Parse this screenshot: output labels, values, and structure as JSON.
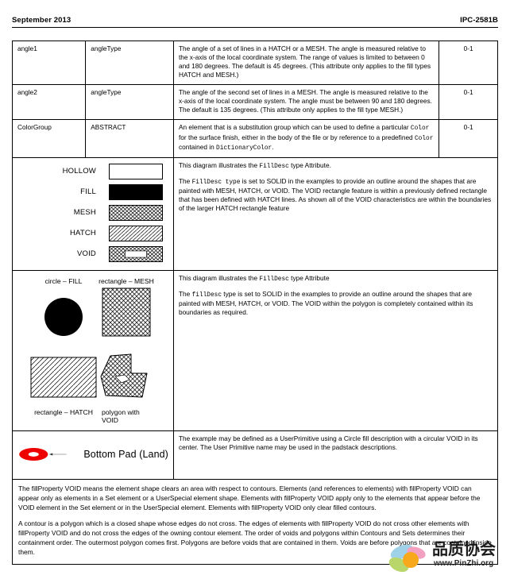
{
  "header": {
    "date": "September 2013",
    "standard": "IPC-2581B"
  },
  "attribute_table": {
    "rows": [
      {
        "name": "angle1",
        "type": "angleType",
        "description": "The angle of a set of lines in a HATCH or a MESH. The angle is measured relative to the x-axis of the local coordinate system. The range of values is limited to between 0 and  180 degrees. The default is 45 degrees. (This attribute only applies to the fill types HATCH and MESH.)",
        "cardinality": "0-1"
      },
      {
        "name": "angle2",
        "type": "angleType",
        "description": "The angle of the second set of lines in a MESH. The angle is measured relative to the x-axis of the local coordinate system. The angle must be between 90 and 180 degrees. The default is 135 degrees. (This attribute only applies to the  fill  type MESH.)",
        "cardinality": "0-1"
      },
      {
        "name": "ColorGroup",
        "type": "ABSTRACT",
        "description_parts": [
          {
            "text": "An element that is a substitution group which can be used to define a particular ",
            "mono": false
          },
          {
            "text": "Color",
            "mono": true
          },
          {
            "text": " for the surface finish, either in the body of the file or by reference to a predefined ",
            "mono": false
          },
          {
            "text": "Color",
            "mono": true
          },
          {
            "text": " contained in ",
            "mono": false
          },
          {
            "text": "DictionaryColor",
            "mono": true
          },
          {
            "text": ".",
            "mono": false
          }
        ],
        "cardinality": "0-1"
      }
    ]
  },
  "fill_types_figure": {
    "swatches": [
      {
        "label": "HOLLOW",
        "pattern": "hollow"
      },
      {
        "label": "FILL",
        "pattern": "solid"
      },
      {
        "label": "MESH",
        "pattern": "mesh"
      },
      {
        "label": "HATCH",
        "pattern": "hatch"
      },
      {
        "label": "VOID",
        "pattern": "void"
      }
    ],
    "description": {
      "line1_pre": "This diagram illustrates the ",
      "line1_mono": "FillDesc",
      "line1_post": " type Attribute.",
      "line2_pre": "The ",
      "line2_mono": "FillDesc type",
      "line2_post": " is set to SOLID in the examples to provide an outline around the shapes that are painted with MESH, HATCH, or VOID. The VOID rectangle feature is within a previously defined rectangle that has been defined with HATCH lines. As shown all of the VOID characteristics are within the boundaries of the larger HATCH rectangle feature"
    }
  },
  "shapes_figure": {
    "captions": {
      "circle_fill": "circle – FILL",
      "rectangle_mesh": "rectangle – MESH",
      "rectangle_hatch": "rectangle – HATCH",
      "polygon_void": "polygon with VOID"
    },
    "description": {
      "line1_pre": "This diagram illustrates the ",
      "line1_mono": "FillDesc",
      "line1_post": " type Attribute",
      "line2_pre": "The ",
      "line2_mono": "fillDesc",
      "line2_post": " type is set to SOLID in the examples to provide an outline around the shapes that are painted with MESH, HATCH, or VOID. The VOID within the polygon is completely contained within its boundaries as required."
    }
  },
  "pad_figure": {
    "label": "Bottom Pad (Land)",
    "pad_color": "#EE0000",
    "description": "The example may be defined as a UserPrimitive using a Circle fill description with a circular VOID in its center. The User Primitive name may be used in the padstack descriptions."
  },
  "notes": {
    "paragraph1": "The fillProperty VOID means the element shape clears an area with respect to contours. Elements (and references to elements) with fillProperty VOID can appear only as elements in a Set element or a UserSpecial element shape.  Elements with fillProperty VOID apply only to the elements that appear before the VOID element in the Set element or in the UserSpecial element.  Elements with fillProperty VOID only clear filled contours.",
    "paragraph2": "A contour is a polygon which is a closed shape whose edges do not cross. The edges of elements with fillProperty VOID do not cross other elements with fillProperty VOID and do not cross the edges of the owning contour element.  The order of voids and polygons within Contours and Sets determines their containment order. The outermost polygon comes first. Polygons are before voids that are contained in them. Voids are before polygons that are contained inside them."
  },
  "watermark": {
    "text": "品质协会",
    "url": "www.PinZhi.org"
  }
}
